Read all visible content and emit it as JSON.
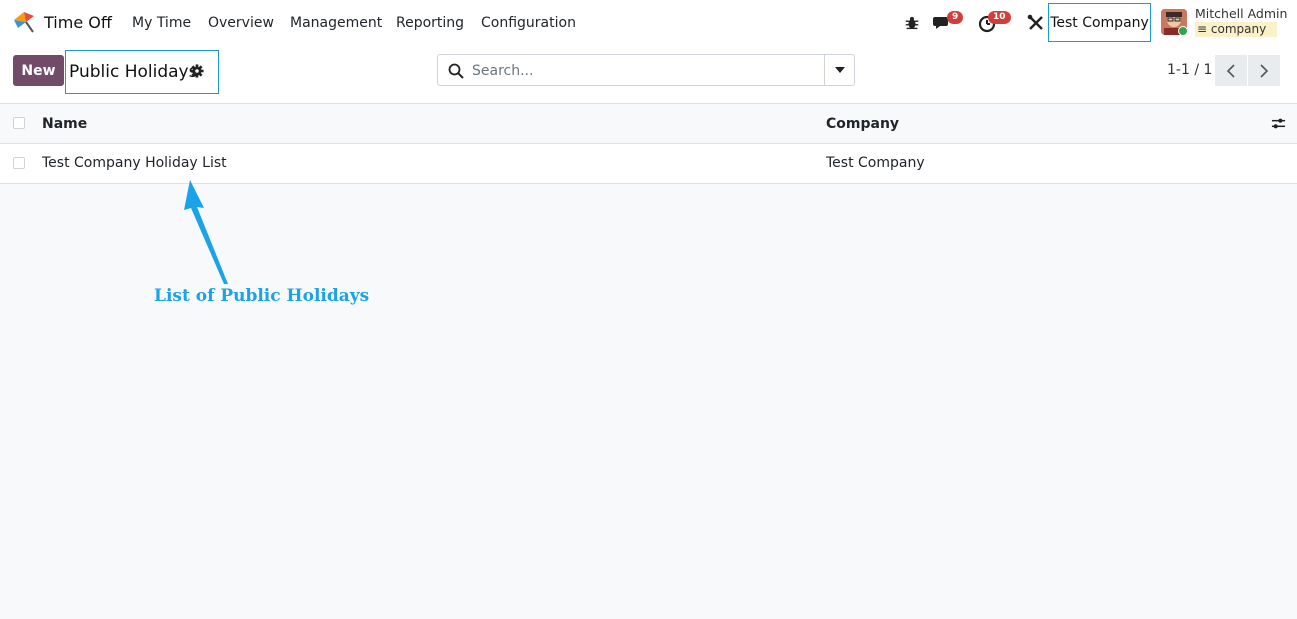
{
  "navbar": {
    "app_name": "Time Off",
    "menu": [
      "My Time",
      "Overview",
      "Management",
      "Reporting",
      "Configuration"
    ],
    "messages_count": "9",
    "activities_count": "10",
    "company": "Test Company",
    "user_name": "Mitchell Admin",
    "database": "company"
  },
  "control_panel": {
    "new_button": "New",
    "title": "Public Holidays",
    "search_placeholder": "Search...",
    "pager": "1-1 / 1"
  },
  "list": {
    "columns": [
      "Name",
      "Company"
    ],
    "rows": [
      {
        "name": "Test Company Holiday List",
        "company": "Test Company"
      }
    ]
  },
  "annotation": {
    "text": "List of Public Holidays"
  },
  "colors": {
    "primary": "#714b67",
    "highlight": "#1d9ad6",
    "annotation": "#1aa3e8",
    "badge": "#d23f3a"
  }
}
